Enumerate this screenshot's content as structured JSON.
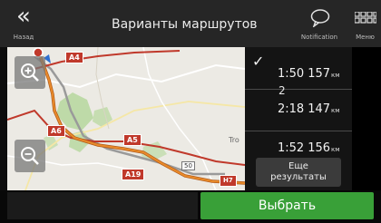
{
  "header": {
    "back_icon": "chevron-double-left-icon",
    "back_label": "Назад",
    "title": "Варианты маршрутов",
    "notification_icon": "speech-bubble-icon",
    "notification_label": "Notification",
    "menu_icon": "grid-icon",
    "menu_label": "Меню"
  },
  "map": {
    "zoom_in_icon": "zoom-in-icon",
    "zoom_out_icon": "zoom-out-icon",
    "roads": {
      "a4": "A4",
      "a6": "A6",
      "a5": "A5",
      "a19": "A19",
      "h7": "H7",
      "n50": "50"
    },
    "place": "Tro"
  },
  "routes": [
    {
      "selected": true,
      "index": "",
      "time": "1:50",
      "distance": "157",
      "unit": "км"
    },
    {
      "selected": false,
      "index": "2",
      "time": "2:18",
      "distance": "147",
      "unit": "км"
    },
    {
      "selected": false,
      "index": "",
      "time": "1:52",
      "distance": "156",
      "unit": "км"
    }
  ],
  "more_results": {
    "line1": "Еще",
    "line2": "результаты"
  },
  "confirm_label": "Выбрать",
  "colors": {
    "header_bg": "#262626",
    "confirm_green": "#39a038",
    "route_red": "#c0392b",
    "map_bg": "#eceae4"
  }
}
